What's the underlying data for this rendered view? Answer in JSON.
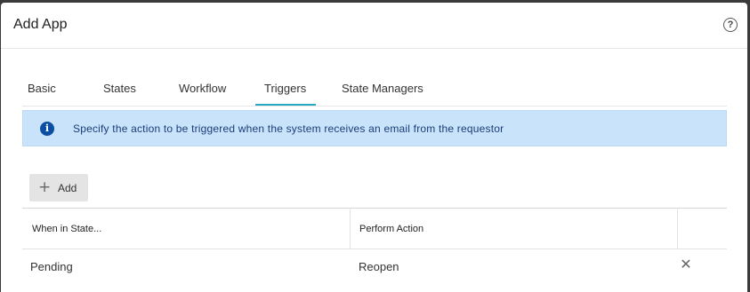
{
  "dialog": {
    "title": "Add App",
    "help_icon": "question-circle-icon",
    "help_glyph": "?"
  },
  "tabs": [
    {
      "label": "Basic"
    },
    {
      "label": "States"
    },
    {
      "label": "Workflow"
    },
    {
      "label": "Triggers",
      "active": true
    },
    {
      "label": "State Managers"
    }
  ],
  "info_banner": {
    "icon": "info-icon",
    "glyph": "i",
    "text": "Specify the action to be triggered when the system receives an email from the requestor"
  },
  "toolbar": {
    "add_icon": "plus-icon",
    "add_glyph": "+",
    "add_label": "Add"
  },
  "table": {
    "headers": [
      "When in State...",
      "Perform Action"
    ],
    "rows": [
      {
        "state": "Pending",
        "action": "Reopen",
        "delete_icon": "close-icon",
        "delete_glyph": "✕"
      }
    ]
  },
  "colors": {
    "tab_active_underline": "#26a9c1",
    "banner_background": "#c9e3fb",
    "banner_text": "#1a3c78",
    "info_icon": "#0b4fa3"
  }
}
